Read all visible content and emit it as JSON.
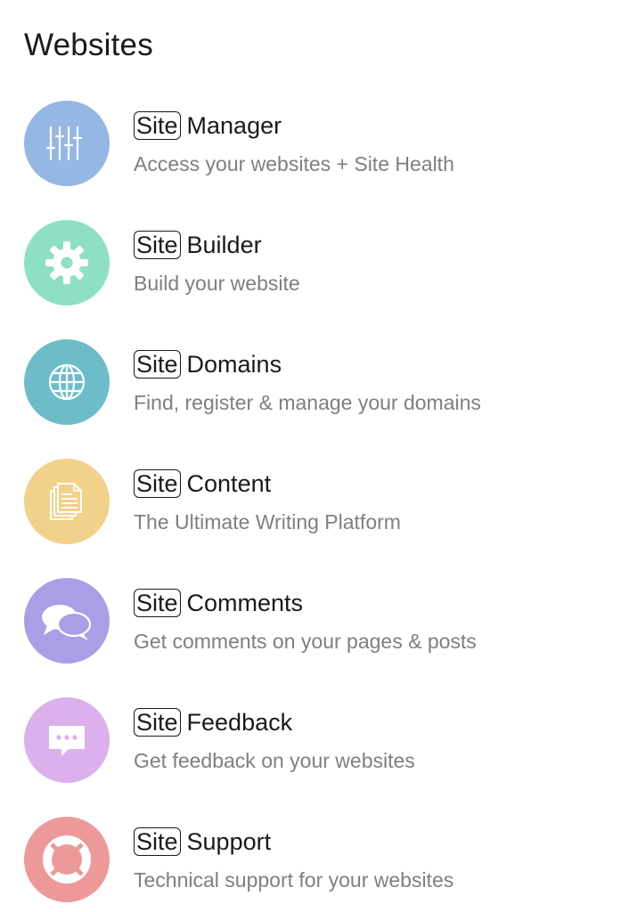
{
  "header": {
    "title": "Websites"
  },
  "brand": "Site",
  "colors": {
    "manager": "#95b7e3",
    "builder": "#8ee0c4",
    "domains": "#6cbdc9",
    "content": "#f2d18b",
    "comments": "#a99fe6",
    "feedback": "#dbb0ec",
    "support": "#ee9999"
  },
  "items": [
    {
      "icon": "sliders-icon",
      "name": "Manager",
      "desc": "Access your websites + Site Health"
    },
    {
      "icon": "gear-icon",
      "name": "Builder",
      "desc": "Build your website"
    },
    {
      "icon": "globe-icon",
      "name": "Domains",
      "desc": "Find, register & manage your domains"
    },
    {
      "icon": "documents-icon",
      "name": "Content",
      "desc": "The Ultimate Writing Platform"
    },
    {
      "icon": "chat-bubbles-icon",
      "name": "Comments",
      "desc": "Get comments on your pages & posts"
    },
    {
      "icon": "feedback-bubble-icon",
      "name": "Feedback",
      "desc": "Get feedback on your websites"
    },
    {
      "icon": "lifebuoy-icon",
      "name": "Support",
      "desc": "Technical support for your websites"
    }
  ]
}
